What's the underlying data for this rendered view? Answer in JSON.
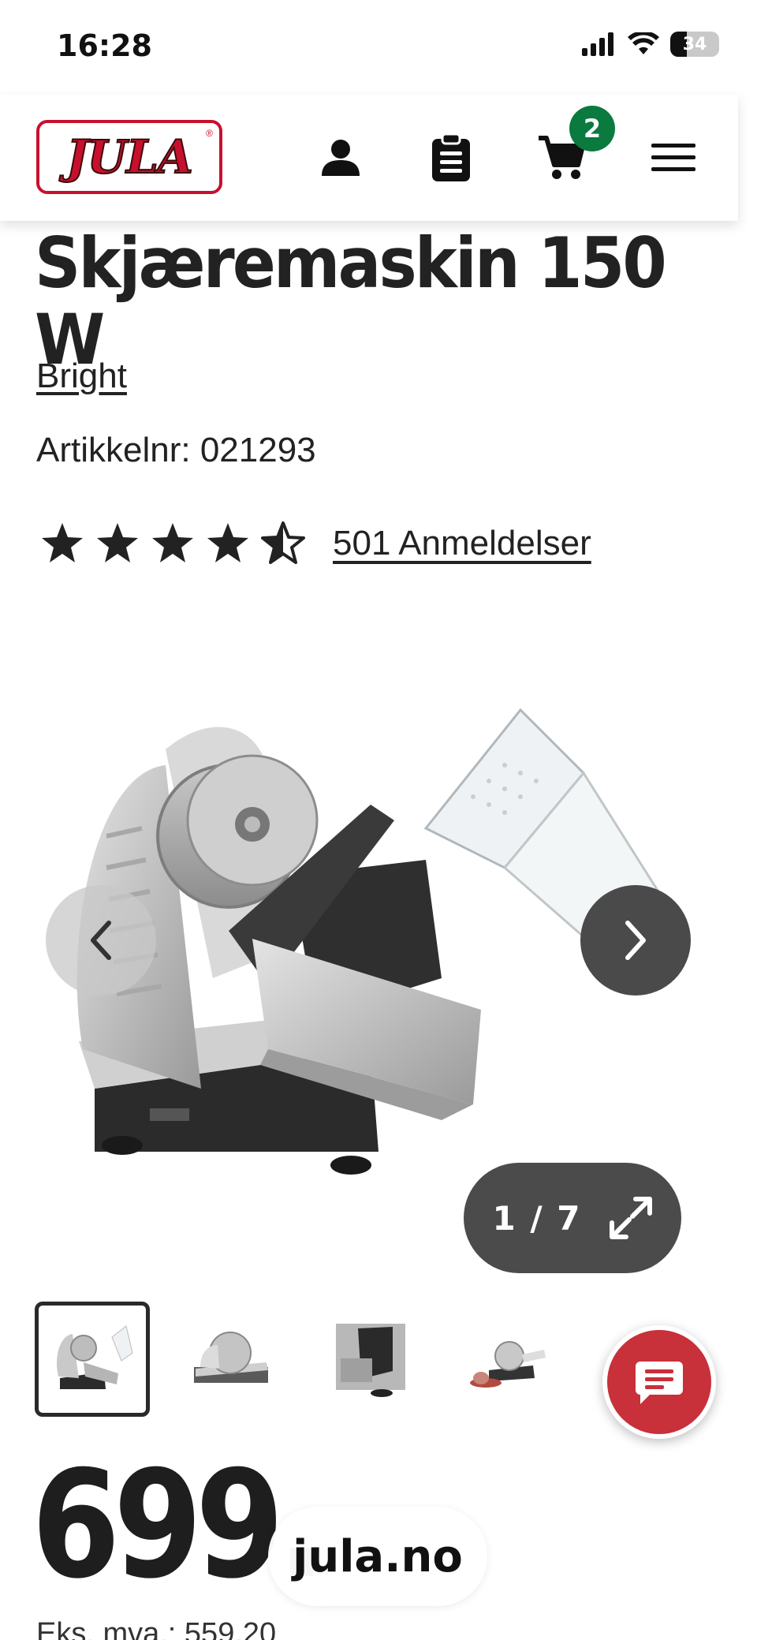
{
  "status_bar": {
    "time": "16:28",
    "battery": "34",
    "battery_fraction": 0.34
  },
  "header": {
    "logo_text": "JULA",
    "logo_reg": "®",
    "cart_count": "2",
    "icons": [
      "user-icon",
      "clipboard-icon",
      "cart-icon",
      "menu-icon"
    ],
    "brand_color": "#c8102e",
    "badge_color": "#0a7a3e"
  },
  "product": {
    "title": "Skjæremaskin 150 W",
    "brand": "Bright",
    "article_number": "Artikkelnr: 021293",
    "rating": 4.5,
    "rating_max": 5,
    "reviews_label": "501 Anmeldelser"
  },
  "gallery": {
    "counter": "1 / 7",
    "current": 1,
    "total": 7,
    "selected_thumbnail": 1,
    "icons": [
      "chevron-left-icon",
      "chevron-right-icon",
      "expand-icon"
    ]
  },
  "price": {
    "amount": "699.",
    "ex_vat": "Eks. mva.: 559,20"
  },
  "browser": {
    "url": "jula.no"
  },
  "chat": {
    "icon": "chat-icon",
    "color": "#c8303a"
  }
}
